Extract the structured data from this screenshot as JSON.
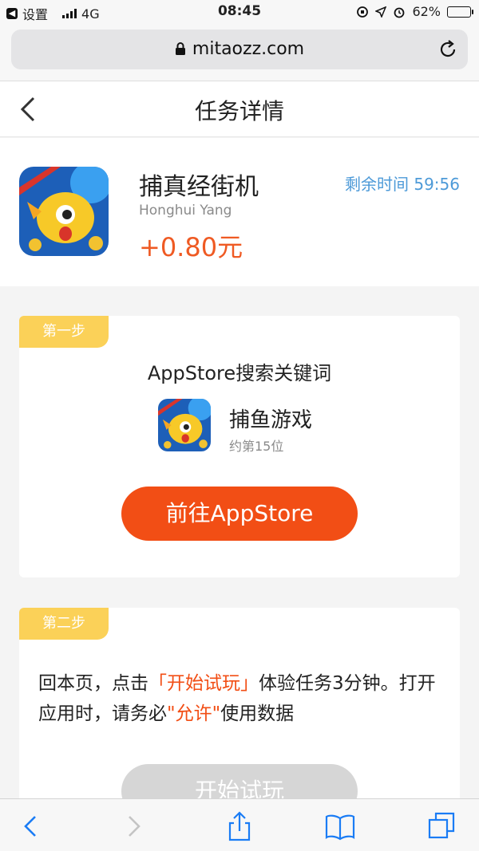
{
  "status_bar": {
    "back_app": "设置",
    "network": "4G",
    "time": "08:45",
    "battery": "62%",
    "battery_level": 0.62
  },
  "browser": {
    "url": "mitaozz.com"
  },
  "header": {
    "title": "任务详情"
  },
  "app": {
    "name": "捕真经街机",
    "developer": "Honghui Yang",
    "reward": "+0.80元",
    "remaining_label": "剩余时间",
    "remaining_time": "59:56",
    "icon": "fish-game-icon"
  },
  "step1": {
    "badge": "第一步",
    "title": "AppStore搜索关键词",
    "keyword": "捕鱼游戏",
    "rank": "约第15位",
    "button": "前往AppStore"
  },
  "step2": {
    "badge": "第二步",
    "desc_part1": "回本页，点击",
    "desc_hl1": "「开始试玩」",
    "desc_part2": "体验任务3分钟。打开应用时，请务必",
    "desc_hl2": "\"允许\"",
    "desc_part3": "使用数据",
    "button": "开始试玩"
  },
  "colors": {
    "accent": "#f24e15",
    "badge": "#fbd158",
    "timer": "#4d9ad8",
    "ios_blue": "#1a7cf5"
  }
}
